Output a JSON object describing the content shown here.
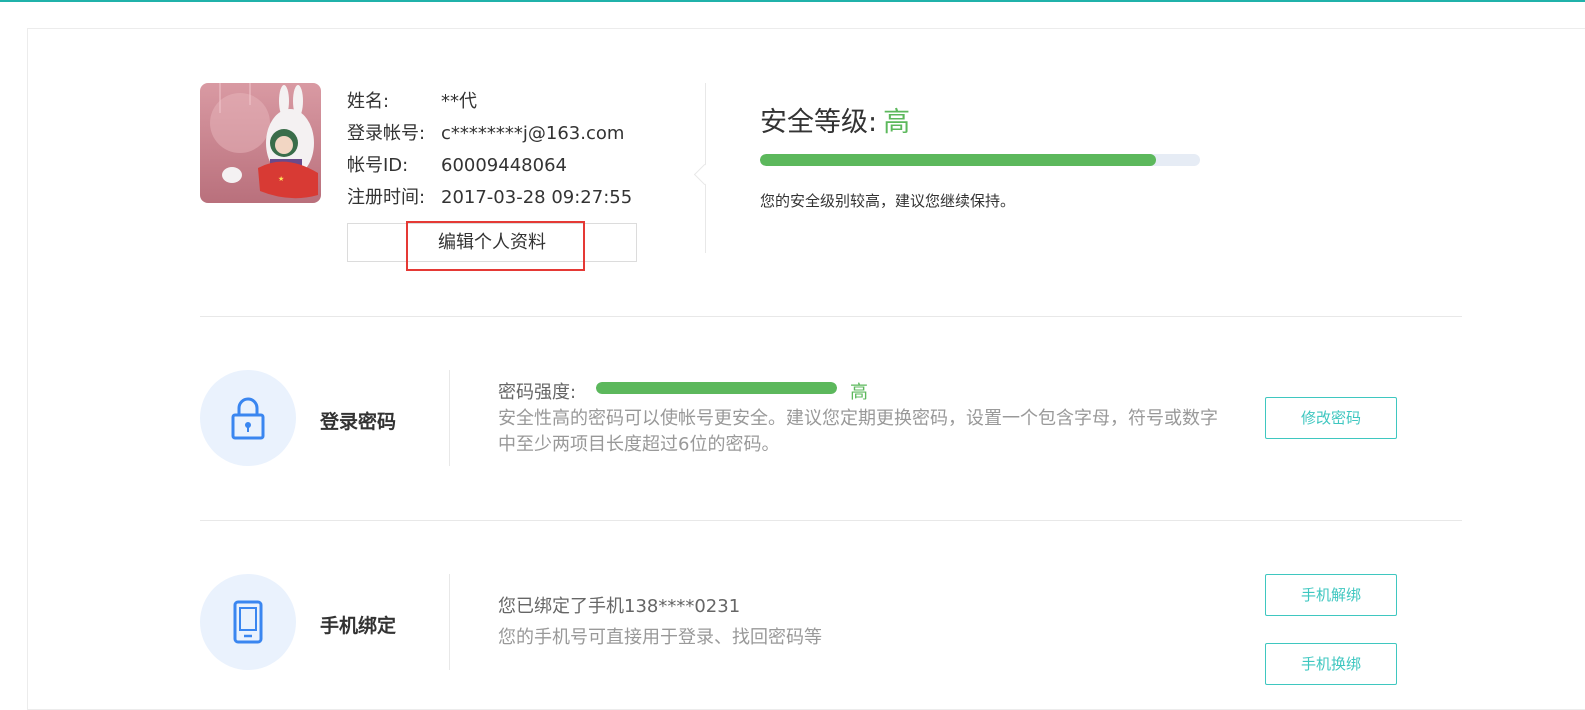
{
  "profile": {
    "rows": [
      {
        "label": "姓名:",
        "value": "**代"
      },
      {
        "label": "登录帐号:",
        "value": "c********j@163.com"
      },
      {
        "label": "帐号ID:",
        "value": "60009448064"
      },
      {
        "label": "注册时间:",
        "value": "2017-03-28 09:27:55"
      }
    ],
    "edit_button": "编辑个人资料"
  },
  "security": {
    "title": "安全等级:",
    "level": "高",
    "progress": 0.9,
    "hint": "您的安全级别较高，建议您继续保持。",
    "accent": "#5cb85c"
  },
  "password": {
    "title": "登录密码",
    "strength_label": "密码强度:",
    "strength_level": "高",
    "strength_progress": 1.0,
    "description": "安全性高的密码可以使帐号更安全。建议您定期更换密码，设置一个包含字母，符号或数字中至少两项目长度超过6位的密码。",
    "button": "修改密码",
    "icon": "lock-icon"
  },
  "phone": {
    "title": "手机绑定",
    "bound_text": "您已绑定了手机138****0231",
    "description": "您的手机号可直接用于登录、找回密码等",
    "unbind_button": "手机解绑",
    "change_button": "手机换绑",
    "icon": "phone-icon"
  }
}
